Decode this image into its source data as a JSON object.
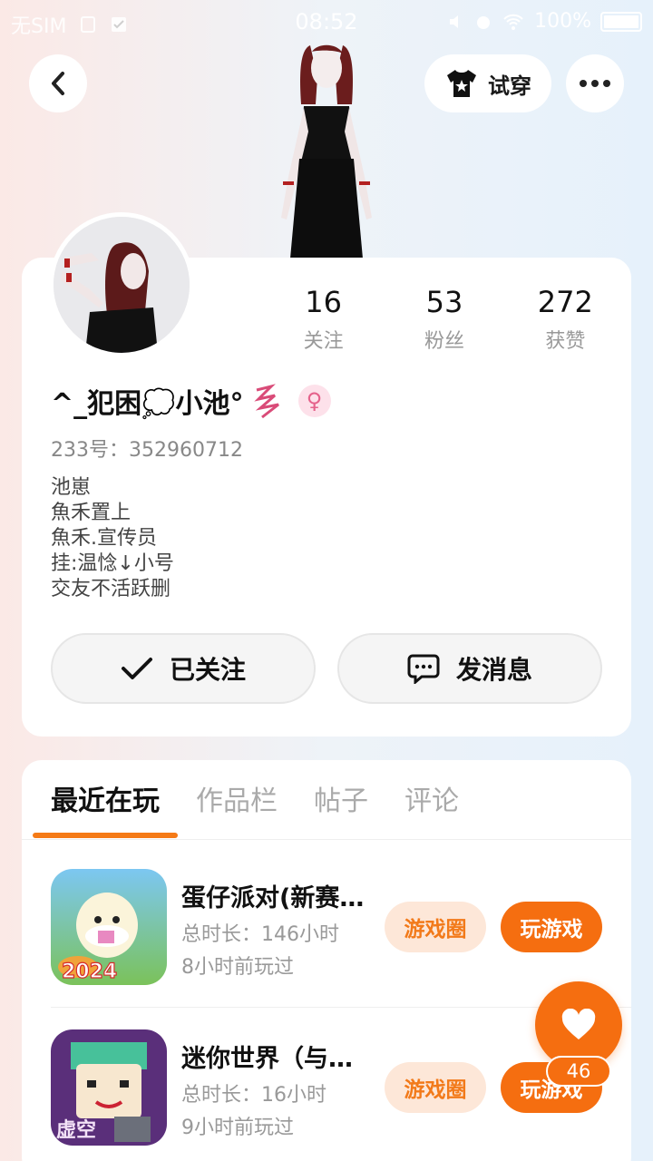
{
  "status_bar": {
    "carrier": "无SIM",
    "time": "08:52",
    "battery": "100%"
  },
  "header": {
    "try_on_label": "试穿",
    "icons": [
      "back-arrow-icon",
      "tshirt-icon",
      "more-dots-icon"
    ]
  },
  "profile": {
    "stats": [
      {
        "value": "16",
        "label": "关注"
      },
      {
        "value": "53",
        "label": "粉丝"
      },
      {
        "value": "272",
        "label": "获赞"
      }
    ],
    "username": "^_犯困💭小池°",
    "uid": "233号：352960712",
    "bio": "池崽\n魚禾置上\n魚禾.宣传员\n挂:温惗↓小号\n交友不活跃删",
    "follow_label": "已关注",
    "message_label": "发消息"
  },
  "tabs": {
    "items": [
      "最近在玩",
      "作品栏",
      "帖子",
      "评论"
    ],
    "active_index": 0
  },
  "games": [
    {
      "title": "蛋仔派对(新赛…",
      "duration": "总时长：146小时",
      "last_played": "8小时前玩过",
      "circle_label": "游戏圈",
      "play_label": "玩游戏",
      "badge": "2024"
    },
    {
      "title": "迷你世界（与…",
      "duration": "总时长：16小时",
      "last_played": "9小时前玩过",
      "circle_label": "游戏圈",
      "play_label": "玩游戏",
      "badge": "虚空"
    }
  ],
  "like_fab": {
    "count": "46"
  },
  "colors": {
    "accent": "#f56e10",
    "accent_light": "#fde7d8",
    "gender": "#e5628b"
  }
}
